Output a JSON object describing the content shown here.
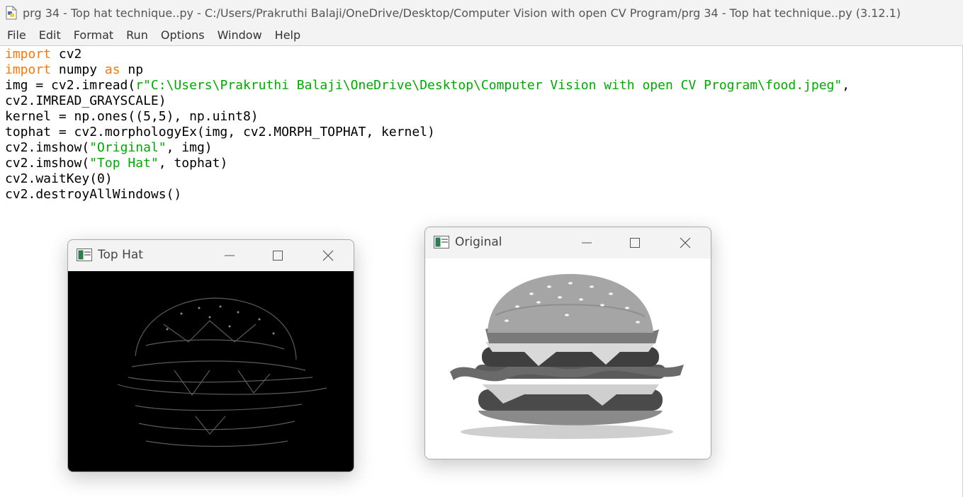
{
  "window": {
    "title": "prg 34 - Top hat technique..py - C:/Users/Prakruthi Balaji/OneDrive/Desktop/Computer Vision with open CV Program/prg 34 - Top hat technique..py (3.12.1)",
    "app_icon": "python-file-icon"
  },
  "menu": [
    "File",
    "Edit",
    "Format",
    "Run",
    "Options",
    "Window",
    "Help"
  ],
  "code_lines": [
    [
      {
        "t": "import",
        "c": "kw"
      },
      {
        "t": " cv2",
        "c": ""
      }
    ],
    [
      {
        "t": "import",
        "c": "kw"
      },
      {
        "t": " numpy ",
        "c": ""
      },
      {
        "t": "as",
        "c": "kw"
      },
      {
        "t": " np",
        "c": ""
      }
    ],
    [
      {
        "t": "img = cv2.imread(",
        "c": ""
      },
      {
        "t": "r\"C:\\Users\\Prakruthi Balaji\\OneDrive\\Desktop\\Computer Vision with open CV Program\\food.jpeg\"",
        "c": "str"
      },
      {
        "t": ",",
        "c": ""
      }
    ],
    [
      {
        "t": "cv2.IMREAD_GRAYSCALE)",
        "c": ""
      }
    ],
    [
      {
        "t": "kernel = np.ones((5,5), np.uint8)",
        "c": ""
      }
    ],
    [
      {
        "t": "tophat = cv2.morphologyEx(img, cv2.MORPH_TOPHAT, kernel)",
        "c": ""
      }
    ],
    [
      {
        "t": "cv2.imshow(",
        "c": ""
      },
      {
        "t": "\"Original\"",
        "c": "str"
      },
      {
        "t": ", img)",
        "c": ""
      }
    ],
    [
      {
        "t": "cv2.imshow(",
        "c": ""
      },
      {
        "t": "\"Top Hat\"",
        "c": "str"
      },
      {
        "t": ", tophat)",
        "c": ""
      }
    ],
    [
      {
        "t": "cv2.waitKey(0)",
        "c": ""
      }
    ],
    [
      {
        "t": "cv2.destroyAllWindows()",
        "c": ""
      }
    ]
  ],
  "windows": {
    "tophat": {
      "title": "Top Hat",
      "icon": "opencv-window-icon"
    },
    "original": {
      "title": "Original",
      "icon": "opencv-window-icon"
    }
  },
  "colors": {
    "keyword": "#ff7700",
    "string": "#00aa00"
  }
}
